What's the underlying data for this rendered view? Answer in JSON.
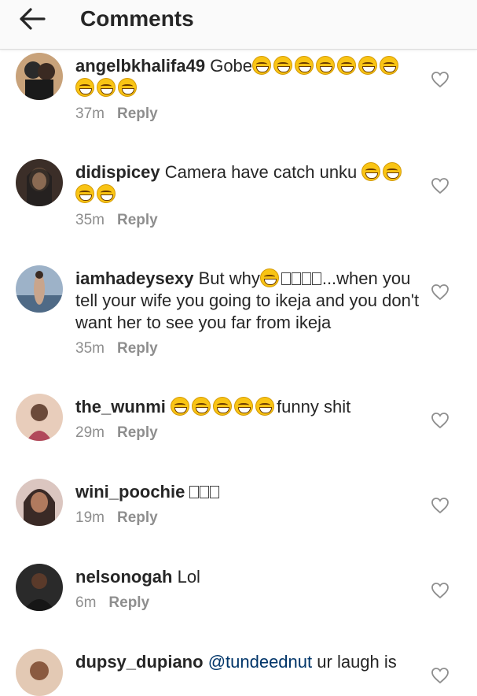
{
  "header": {
    "title": "Comments"
  },
  "comments": [
    {
      "username": "angelbkhalifa49",
      "text": "Gobe",
      "emoji": [
        "grinning-squinting-face",
        "grinning-squinting-face",
        "grinning-squinting-face",
        "grinning-squinting-face",
        "grinning-squinting-face",
        "grinning-squinting-face",
        "grinning-squinting-face",
        "grinning-squinting-face",
        "grinning-squinting-face",
        "grinning-squinting-face"
      ],
      "time": "37m",
      "reply_label": "Reply",
      "avatar_colors": [
        "#2a2a2a",
        "#c8a27a"
      ]
    },
    {
      "username": "didispicey",
      "text": "Camera have catch unku",
      "emoji": [
        "grinning-squinting-face",
        "grinning-squinting-face",
        "grinning-squinting-face",
        "grinning-squinting-face"
      ],
      "time": "35m",
      "reply_label": "Reply",
      "avatar_colors": [
        "#1c1c1c",
        "#7a5b44"
      ]
    },
    {
      "username": "iamhadeysexy",
      "text_before": "But why",
      "text_after": "...when you tell your wife you going to ikeja and you don't want her to see you far from ikeja",
      "emoji": [
        "grinning-squinting-face"
      ],
      "missing_glyphs": 4,
      "time": "35m",
      "reply_label": "Reply",
      "avatar_colors": [
        "#9db2c8",
        "#4f6a86"
      ]
    },
    {
      "username": "the_wunmi",
      "text": "funny shit",
      "emoji": [
        "grinning-squinting-face",
        "grinning-squinting-face",
        "grinning-squinting-face",
        "grinning-squinting-face",
        "grinning-squinting-face"
      ],
      "time": "29m",
      "reply_label": "Reply",
      "avatar_colors": [
        "#e8cdbb",
        "#b1485a"
      ]
    },
    {
      "username": "wini_poochie",
      "missing_glyphs": 3,
      "time": "19m",
      "reply_label": "Reply",
      "avatar_colors": [
        "#dbc6c0",
        "#3a2a26"
      ]
    },
    {
      "username": "nelsonogah",
      "text": "Lol",
      "time": "6m",
      "reply_label": "Reply",
      "avatar_colors": [
        "#161616",
        "#5a3a2a"
      ]
    },
    {
      "username": "dupsy_dupiano",
      "mention": "@tundeednut",
      "text": "ur laugh is",
      "avatar_colors": [
        "#e3c9b4",
        "#8a5a40"
      ]
    }
  ],
  "icons": {
    "back": "arrow-left-icon",
    "like": "heart-outline-icon",
    "emoji": "grinning-squinting-face"
  }
}
